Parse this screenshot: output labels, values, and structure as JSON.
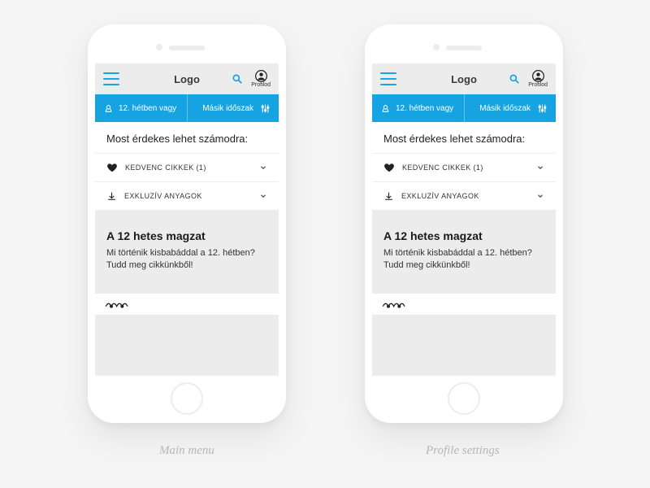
{
  "header": {
    "logo": "Logo",
    "profile_label": "Profilod"
  },
  "bluebar": {
    "week_text": "12. hétben vagy",
    "other_period": "Másik időszak"
  },
  "section": {
    "title": "Most érdekes lehet számodra:"
  },
  "accordions": [
    {
      "label": "KEDVENC CIKKEK (1)"
    },
    {
      "label": "EXKLUZÍV ANYAGOK"
    }
  ],
  "card": {
    "title": "A 12 hetes magzat",
    "body": "Mi történik kisbabáddal a 12. hétben? Tudd meg cikkünkből!"
  },
  "captions": {
    "left": "Main menu",
    "right": "Profile settings"
  }
}
